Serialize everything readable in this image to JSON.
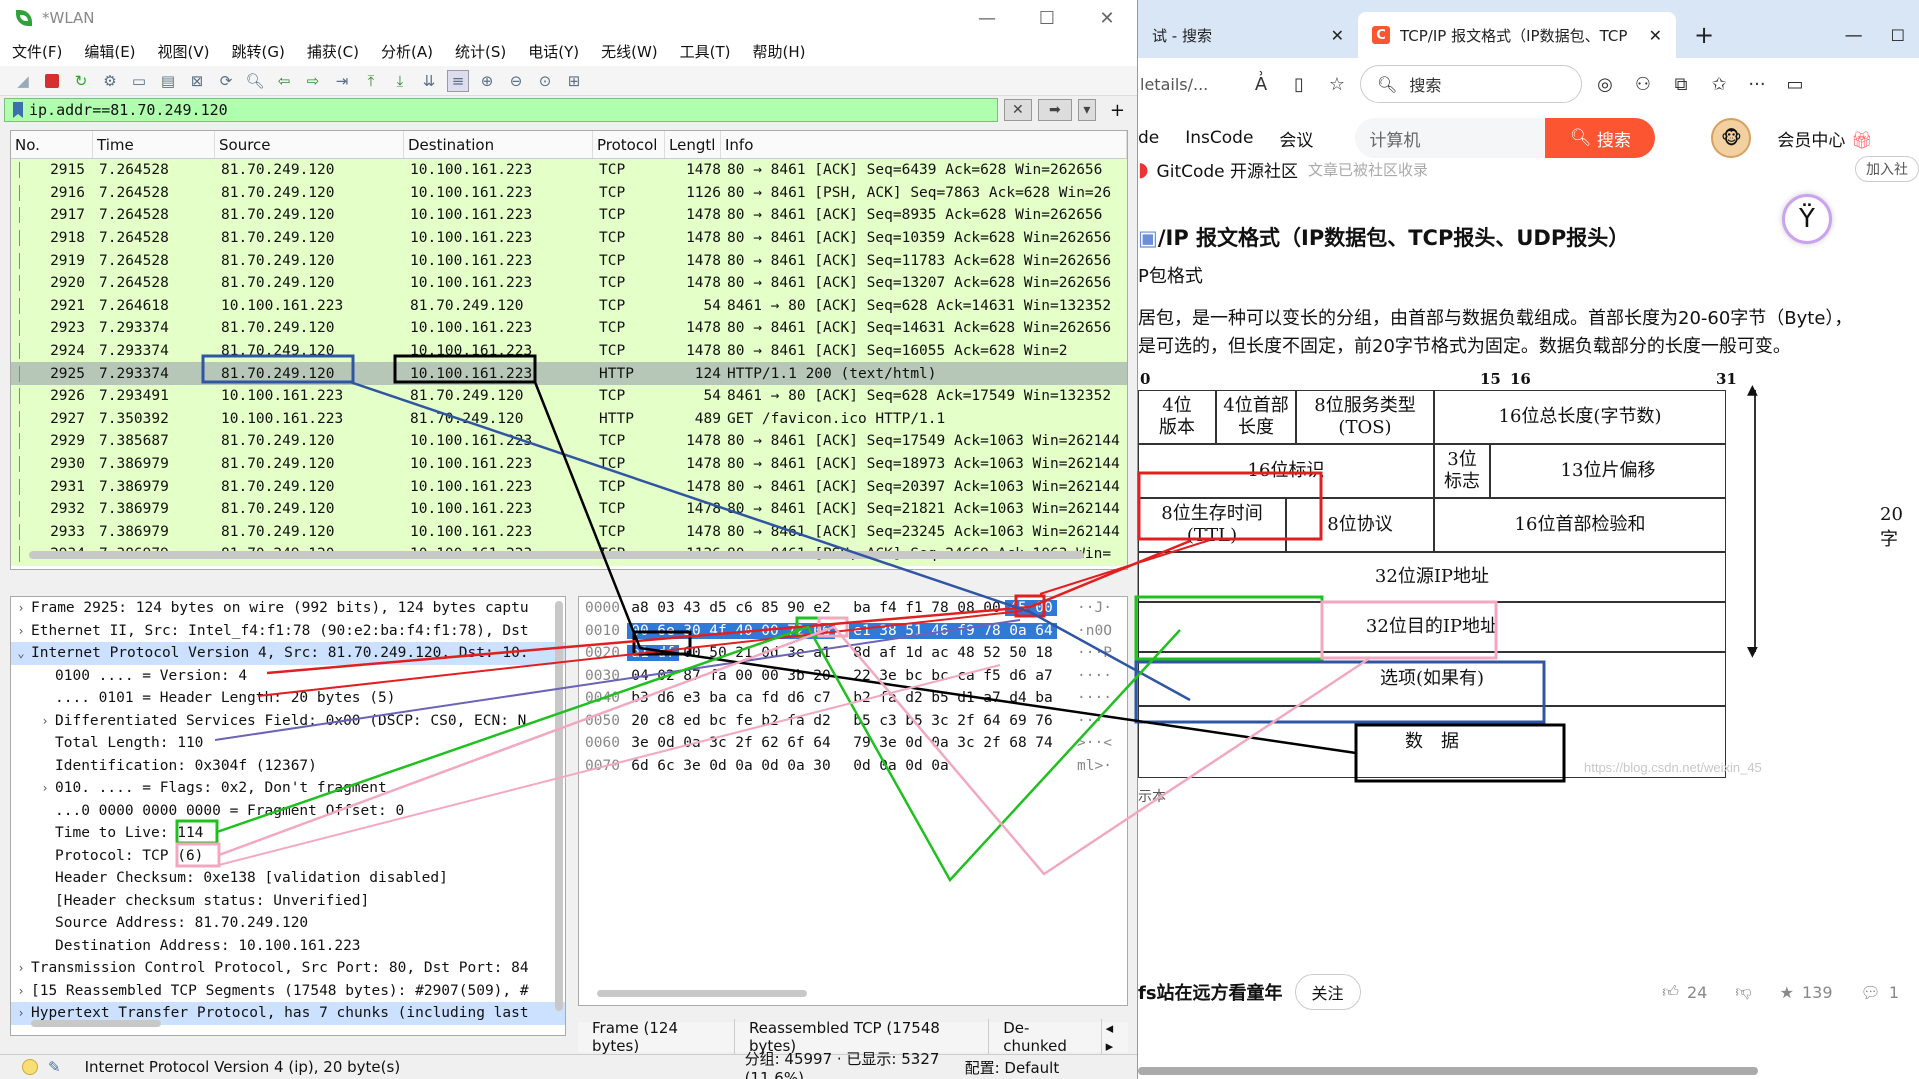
{
  "wireshark": {
    "title": "*WLAN",
    "menu": [
      "文件(F)",
      "编辑(E)",
      "视图(V)",
      "跳转(G)",
      "捕获(C)",
      "分析(A)",
      "统计(S)",
      "电话(Y)",
      "无线(W)",
      "工具(T)",
      "帮助(H)"
    ],
    "filter": "ip.addr==81.70.249.120",
    "columns": [
      "No.",
      "Time",
      "Source",
      "Destination",
      "Protocol",
      "Lengtl",
      "Info"
    ],
    "packets": [
      {
        "no": "2915",
        "time": "7.264528",
        "src": "81.70.249.120",
        "dst": "10.100.161.223",
        "proto": "TCP",
        "len": "1478",
        "info": "80 → 8461 [ACK] Seq=6439 Ack=628 Win=262656"
      },
      {
        "no": "2916",
        "time": "7.264528",
        "src": "81.70.249.120",
        "dst": "10.100.161.223",
        "proto": "TCP",
        "len": "1126",
        "info": "80 → 8461 [PSH, ACK] Seq=7863 Ack=628 Win=26"
      },
      {
        "no": "2917",
        "time": "7.264528",
        "src": "81.70.249.120",
        "dst": "10.100.161.223",
        "proto": "TCP",
        "len": "1478",
        "info": "80 → 8461 [ACK] Seq=8935 Ack=628 Win=262656"
      },
      {
        "no": "2918",
        "time": "7.264528",
        "src": "81.70.249.120",
        "dst": "10.100.161.223",
        "proto": "TCP",
        "len": "1478",
        "info": "80 → 8461 [ACK] Seq=10359 Ack=628 Win=262656"
      },
      {
        "no": "2919",
        "time": "7.264528",
        "src": "81.70.249.120",
        "dst": "10.100.161.223",
        "proto": "TCP",
        "len": "1478",
        "info": "80 → 8461 [ACK] Seq=11783 Ack=628 Win=262656"
      },
      {
        "no": "2920",
        "time": "7.264528",
        "src": "81.70.249.120",
        "dst": "10.100.161.223",
        "proto": "TCP",
        "len": "1478",
        "info": "80 → 8461 [ACK] Seq=13207 Ack=628 Win=262656"
      },
      {
        "no": "2921",
        "time": "7.264618",
        "src": "10.100.161.223",
        "dst": "81.70.249.120",
        "proto": "TCP",
        "len": "54",
        "info": "8461 → 80 [ACK] Seq=628 Ack=14631 Win=132352"
      },
      {
        "no": "2923",
        "time": "7.293374",
        "src": "81.70.249.120",
        "dst": "10.100.161.223",
        "proto": "TCP",
        "len": "1478",
        "info": "80 → 8461 [ACK] Seq=14631 Ack=628 Win=262656"
      },
      {
        "no": "2924",
        "time": "7.293374",
        "src": "81.70.249.120",
        "dst": "10.100.161.223",
        "proto": "TCP",
        "len": "1478",
        "info": "80 → 8461 [ACK] Seq=16055 Ack=628 Win=2"
      },
      {
        "no": "2925",
        "time": "7.293374",
        "src": "81.70.249.120",
        "dst": "10.100.161.223",
        "proto": "HTTP",
        "len": "124",
        "info": "HTTP/1.1 200  (text/html)"
      },
      {
        "no": "2926",
        "time": "7.293491",
        "src": "10.100.161.223",
        "dst": "81.70.249.120",
        "proto": "TCP",
        "len": "54",
        "info": "8461 → 80 [ACK] Seq=628 Ack=17549 Win=132352"
      },
      {
        "no": "2927",
        "time": "7.350392",
        "src": "10.100.161.223",
        "dst": "81.70.249.120",
        "proto": "HTTP",
        "len": "489",
        "info": "GET /favicon.ico HTTP/1.1"
      },
      {
        "no": "2929",
        "time": "7.385687",
        "src": "81.70.249.120",
        "dst": "10.100.161.223",
        "proto": "TCP",
        "len": "1478",
        "info": "80 → 8461 [ACK] Seq=17549 Ack=1063 Win=262144"
      },
      {
        "no": "2930",
        "time": "7.386979",
        "src": "81.70.249.120",
        "dst": "10.100.161.223",
        "proto": "TCP",
        "len": "1478",
        "info": "80 → 8461 [ACK] Seq=18973 Ack=1063 Win=262144"
      },
      {
        "no": "2931",
        "time": "7.386979",
        "src": "81.70.249.120",
        "dst": "10.100.161.223",
        "proto": "TCP",
        "len": "1478",
        "info": "80 → 8461 [ACK] Seq=20397 Ack=1063 Win=262144"
      },
      {
        "no": "2932",
        "time": "7.386979",
        "src": "81.70.249.120",
        "dst": "10.100.161.223",
        "proto": "TCP",
        "len": "1478",
        "info": "80 → 8461 [ACK] Seq=21821 Ack=1063 Win=262144"
      },
      {
        "no": "2933",
        "time": "7.386979",
        "src": "81.70.249.120",
        "dst": "10.100.161.223",
        "proto": "TCP",
        "len": "1478",
        "info": "80 → 8461 [ACK] Seq=23245 Ack=1063 Win=262144"
      },
      {
        "no": "2934",
        "time": "7.386979",
        "src": "81.70.249.120",
        "dst": "10.100.161.223",
        "proto": "TCP",
        "len": "1126",
        "info": "80 → 8461 [PSH, ACK] Seq=24669 Ack=1063 Win="
      }
    ],
    "details": [
      {
        "text": "Frame 2925: 124 bytes on wire (992 bits), 124 bytes captu",
        "arrow": "›",
        "indent": false
      },
      {
        "text": "Ethernet II, Src: Intel_f4:f1:78 (90:e2:ba:f4:f1:78), Dst",
        "arrow": "›",
        "indent": false
      },
      {
        "text": "Internet Protocol Version 4, Src: 81.70.249.120, Dst: 10.",
        "arrow": "⌄",
        "indent": false,
        "hl": true
      },
      {
        "text": "0100 .... = Version: 4",
        "arrow": "",
        "indent": true
      },
      {
        "text": ".... 0101 = Header Length: 20 bytes (5)",
        "arrow": "",
        "indent": true
      },
      {
        "text": "Differentiated Services Field: 0x00 (DSCP: CS0, ECN: N",
        "arrow": "›",
        "indent": true
      },
      {
        "text": "Total Length: 110",
        "arrow": "",
        "indent": true
      },
      {
        "text": "Identification: 0x304f (12367)",
        "arrow": "",
        "indent": true
      },
      {
        "text": "010. .... = Flags: 0x2, Don't fragment",
        "arrow": "›",
        "indent": true
      },
      {
        "text": "...0 0000 0000 0000 = Fragment Offset: 0",
        "arrow": "",
        "indent": true
      },
      {
        "text": "Time to Live: 114",
        "arrow": "",
        "indent": true
      },
      {
        "text": "Protocol: TCP (6)",
        "arrow": "",
        "indent": true
      },
      {
        "text": "Header Checksum: 0xe138 [validation disabled]",
        "arrow": "",
        "indent": true
      },
      {
        "text": "[Header checksum status: Unverified]",
        "arrow": "",
        "indent": true
      },
      {
        "text": "Source Address: 81.70.249.120",
        "arrow": "",
        "indent": true
      },
      {
        "text": "Destination Address: 10.100.161.223",
        "arrow": "",
        "indent": true
      },
      {
        "text": "Transmission Control Protocol, Src Port: 80, Dst Port: 84",
        "arrow": "›",
        "indent": false
      },
      {
        "text": "[15 Reassembled TCP Segments (17548 bytes): #2907(509), #",
        "arrow": "›",
        "indent": false
      },
      {
        "text": "Hypertext Transfer Protocol, has 7 chunks (including last",
        "arrow": "›",
        "indent": false,
        "hl": true
      }
    ],
    "bytes": [
      {
        "off": "0000",
        "hex": [
          "a8",
          "03",
          "43",
          "d5",
          "c6",
          "85",
          "90",
          "e2",
          "ba",
          "f4",
          "f1",
          "78",
          "08",
          "00",
          "45",
          "00"
        ],
        "sel": [
          14,
          15
        ],
        "asc": "··J·"
      },
      {
        "off": "0010",
        "hex": [
          "00",
          "6e",
          "30",
          "4f",
          "40",
          "00",
          "72",
          "06",
          "e1",
          "38",
          "51",
          "46",
          "f9",
          "78",
          "0a",
          "64"
        ],
        "sel": [
          0,
          1,
          2,
          3,
          4,
          5,
          6,
          7,
          8,
          9,
          10,
          11,
          12,
          13,
          14,
          15
        ],
        "asc": "·n0O"
      },
      {
        "off": "0020",
        "hex": [
          "a1",
          "df",
          "00",
          "50",
          "21",
          "0d",
          "3e",
          "a1",
          "8d",
          "af",
          "1d",
          "ac",
          "48",
          "52",
          "50",
          "18"
        ],
        "sel": [
          0,
          1
        ],
        "asc": "···P"
      },
      {
        "off": "0030",
        "hex": [
          "04",
          "02",
          "87",
          "fa",
          "00",
          "00",
          "3b",
          "20",
          "22",
          "3e",
          "bc",
          "bc",
          "ca",
          "f5",
          "d6",
          "a7"
        ],
        "sel": [],
        "asc": "····"
      },
      {
        "off": "0040",
        "hex": [
          "b3",
          "d6",
          "e3",
          "ba",
          "ca",
          "fd",
          "d6",
          "c7",
          "b2",
          "fa",
          "d2",
          "b5",
          "d1",
          "a7",
          "d4",
          "ba"
        ],
        "sel": [],
        "asc": "····"
      },
      {
        "off": "0050",
        "hex": [
          "20",
          "c8",
          "ed",
          "bc",
          "fe",
          "b2",
          "fa",
          "d2",
          "b5",
          "c3",
          "b5",
          "3c",
          "2f",
          "64",
          "69",
          "76"
        ],
        "sel": [],
        "asc": " ···"
      },
      {
        "off": "0060",
        "hex": [
          "3e",
          "0d",
          "0a",
          "3c",
          "2f",
          "62",
          "6f",
          "64",
          "79",
          "3e",
          "0d",
          "0a",
          "3c",
          "2f",
          "68",
          "74"
        ],
        "sel": [],
        "asc": ">··<"
      },
      {
        "off": "0070",
        "hex": [
          "6d",
          "6c",
          "3e",
          "0d",
          "0a",
          "0d",
          "0a",
          "30",
          "0d",
          "0a",
          "0d",
          "0a"
        ],
        "sel": [],
        "asc": "ml>·"
      }
    ],
    "byte_tabs": [
      "Frame (124 bytes)",
      "Reassembled TCP (17548 bytes)",
      "De-chunked"
    ],
    "status_left": "Internet Protocol Version 4 (ip), 20 byte(s)",
    "status_mid": "分组: 45997 · 已显示: 5327 (11.6%)",
    "status_right": "配置: Default"
  },
  "browser": {
    "tab_inactive": "试 - 搜索",
    "tab_active": "TCP/IP 报文格式（IP数据包、TCP",
    "url": "letails/...",
    "search_placeholder": "搜索",
    "csdn_nav": [
      "de",
      "InsCode",
      "会议"
    ],
    "csdn_search": "计算机",
    "csdn_search_btn": "搜索",
    "member": "会员中心",
    "gitcode": "GitCode 开源社区",
    "gitcode_note": "文章已被社区收录",
    "join": "加入社",
    "article_title": "/IP 报文格式（IP数据包、TCP报头、UDP报头）",
    "subheading": "P包格式",
    "para1": "居包，是一种可以变长的分组，由首部与数据负载组成。首部长度为20-60字节（Byte），",
    "para2": "是可选的，但长度不固定，前20字节格式为固定。数据负载部分的长度一般可变。",
    "fig": {
      "bit0": "0",
      "bit15": "15",
      "bit16": "16",
      "bit31": "31",
      "version": "4位\n版本",
      "ihl": "4位首部\n长度",
      "tos": "8位服务类型\n(TOS)",
      "total": "16位总长度(字节数)",
      "ident": "16位标识",
      "flags": "3位\n标志",
      "frag": "13位片偏移",
      "ttl": "8位生存时间\n(TTL)",
      "proto": "8位协议",
      "cksum": "16位首部检验和",
      "src": "32位源IP地址",
      "dst": "32位目的IP地址",
      "opts": "选项(如果有)",
      "data": "数　据",
      "side": "20字",
      "watermark": "https://blog.csdn.net/weixin_45"
    },
    "footer_author": "fs站在远方看童年",
    "follow": "关注",
    "likes": "24",
    "stars": "139",
    "comments": "1",
    "below_fig": "示本"
  }
}
